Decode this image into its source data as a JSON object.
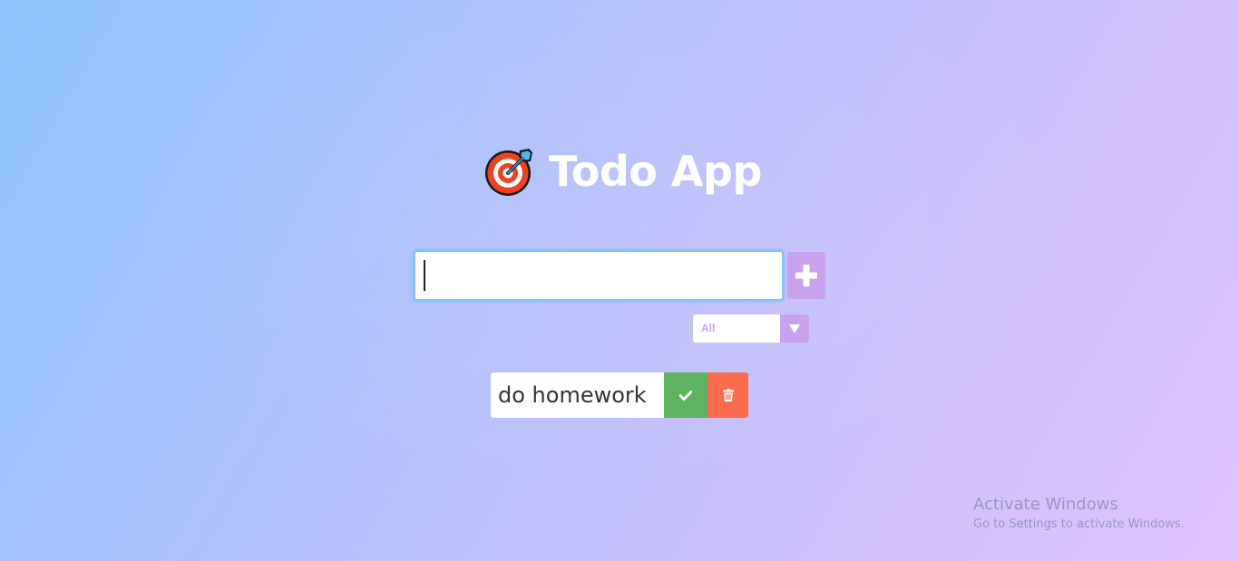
{
  "header": {
    "logo_icon": "bullseye-target-icon",
    "title": "Todo App"
  },
  "input": {
    "value": "",
    "placeholder": ""
  },
  "add_button": {
    "icon": "plus-icon"
  },
  "filter": {
    "selected": "All",
    "arrow_icon": "caret-down-icon"
  },
  "todos": [
    {
      "text": "do homework",
      "complete_icon": "check-icon",
      "delete_icon": "trash-icon"
    }
  ],
  "watermark": {
    "title": "Activate Windows",
    "subtitle": "Go to Settings to activate Windows."
  },
  "colors": {
    "accent": "#c9a2ee",
    "complete": "#5fb35f",
    "delete": "#fb6b4c",
    "input_focus": "#7fc4f7"
  }
}
